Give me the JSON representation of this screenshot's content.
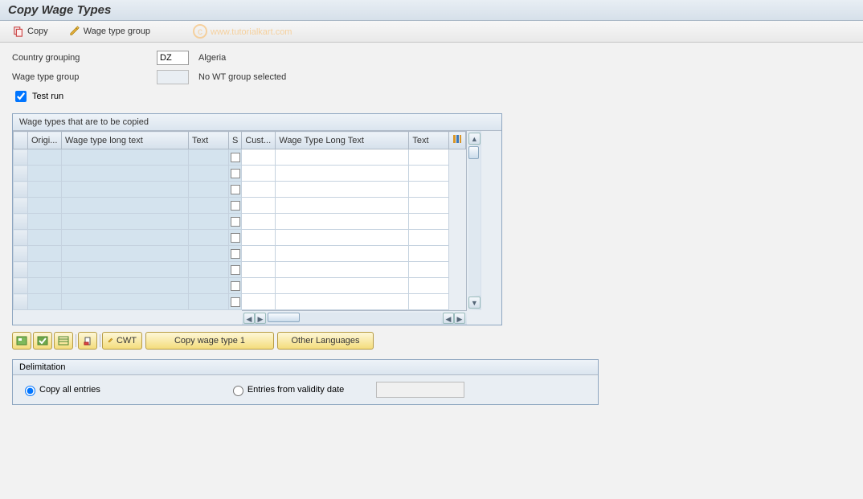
{
  "title": "Copy Wage Types",
  "toolbar": {
    "copy": "Copy",
    "wage_type_group": "Wage type group"
  },
  "watermark": "www.tutorialkart.com",
  "form": {
    "country_grouping_label": "Country grouping",
    "country_grouping_value": "DZ",
    "country_grouping_desc": "Algeria",
    "wage_type_group_label": "Wage type group",
    "wage_type_group_value": "",
    "wage_type_group_desc": "No WT group selected",
    "test_run_label": "Test run",
    "test_run_checked": true
  },
  "grid": {
    "title": "Wage types that are to be copied",
    "columns": {
      "orig": "Origi...",
      "long1": "Wage type long text",
      "text1": "Text",
      "s": "S",
      "cust": "Cust...",
      "long2": "Wage Type Long Text",
      "text2": "Text"
    },
    "rows": [
      {},
      {},
      {},
      {},
      {},
      {},
      {},
      {},
      {},
      {}
    ]
  },
  "buttons": {
    "cwt": "CWT",
    "copy_wt1": "Copy wage type 1",
    "other_lang": "Other Languages"
  },
  "delimitation": {
    "title": "Delimitation",
    "copy_all": "Copy all entries",
    "entries_from": "Entries from validity date",
    "selected": "copy_all",
    "date_value": ""
  }
}
